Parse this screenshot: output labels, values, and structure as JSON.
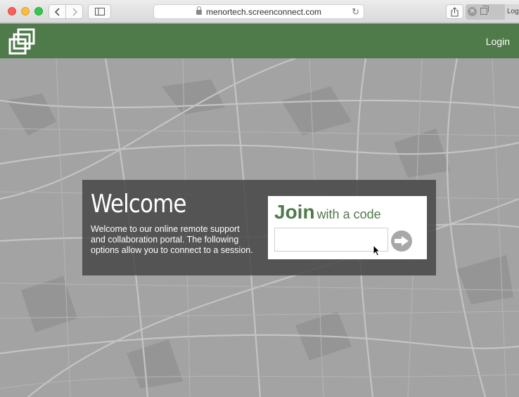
{
  "browser": {
    "url": "menortech.screenconnect.com",
    "tab_peek_label": "Log"
  },
  "header": {
    "login_label": "Login"
  },
  "welcome": {
    "title": "Welcome",
    "description": "Welcome to our online remote support and collaboration portal. The following options allow you to connect to a session."
  },
  "join": {
    "heading_bold": "Join",
    "heading_rest": "with a code",
    "code_value": "",
    "code_placeholder": ""
  },
  "colors": {
    "brand_green": "#4f7a4a",
    "panel_bg": "#464646",
    "map_bg": "#a3a3a3"
  }
}
